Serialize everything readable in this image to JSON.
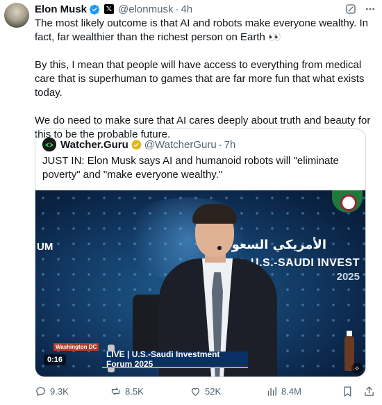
{
  "author": {
    "name": "Elon Musk",
    "handle": "@elonmusk",
    "time": "4h"
  },
  "body": [
    "The most likely outcome is that AI and robots make everyone wealthy. In fact, far wealthier than the richest person on Earth 👀",
    "By this, I mean that people will have access to everything from medical care that is superhuman to games that are far more fun that what exists today.",
    "We do need to make sure that AI cares deeply about truth and beauty for this to be the probable future."
  ],
  "quote": {
    "name": "Watcher.Guru",
    "handle": "@WatcherGuru",
    "time": "7h",
    "text": "JUST IN: Elon Musk says AI and humanoid robots will \"eliminate poverty\" and \"make everyone wealthy.\"",
    "media": {
      "sign_arabic": "الأمريكي السعودي",
      "sign_english": "U.S.-SAUDI INVEST",
      "sign_year": "2025",
      "sign_left": "UM",
      "location_tag": "Washington DC",
      "live_text": "LIVE | U.S.-Saudi Investment Forum 2025",
      "timecode": "0:16"
    }
  },
  "actions": {
    "replies": "9.3K",
    "reposts": "8.5K",
    "likes": "52K",
    "views": "8.4M"
  },
  "colors": {
    "verified_blue": "#1d9bf0",
    "gold_badge": "#e2b719",
    "muted": "#536471"
  }
}
